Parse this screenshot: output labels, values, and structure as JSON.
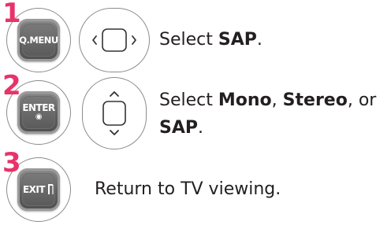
{
  "steps": [
    {
      "number": "1",
      "key_label": "Q.MENU",
      "nav_icon": "left-right-arrows-icon",
      "text": {
        "prefix": "Select ",
        "bold": "SAP",
        "suffix": "."
      }
    },
    {
      "number": "2",
      "key_label": "ENTER",
      "key_sublabel": "◉",
      "nav_icon": "up-down-arrows-icon",
      "text": {
        "prefix": "Select ",
        "bold1": "Mono",
        "sep1": ", ",
        "bold2": "Stereo",
        "sep2": ", or",
        "bold3": "SAP",
        "suffix": "."
      }
    },
    {
      "number": "3",
      "key_label": "EXIT",
      "key_icon": "exit-bracket-icon",
      "text": {
        "plain": "Return to TV viewing."
      }
    }
  ],
  "colors": {
    "step_number": "#e8336a",
    "key_fill": "#5f5f5f",
    "ring_stroke": "#8c8c8c",
    "text": "#231f20"
  }
}
